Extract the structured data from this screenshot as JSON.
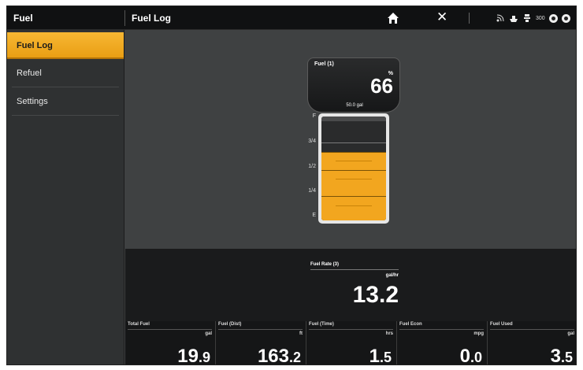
{
  "app": {
    "title": "Fuel"
  },
  "header": {
    "title": "Fuel Log"
  },
  "sidebar": {
    "items": [
      {
        "label": "Fuel Log"
      },
      {
        "label": "Refuel"
      },
      {
        "label": "Settings"
      }
    ]
  },
  "status": {
    "badge_text": "300"
  },
  "gauge": {
    "name": "Fuel (1)",
    "unit": "%",
    "value": "66",
    "capacity": "50.0 gal",
    "level_fraction": 0.66,
    "marks": [
      "F",
      "3/4",
      "1/2",
      "1/4",
      "E"
    ],
    "fill_color": "#f2a61f"
  },
  "fuel_rate": {
    "name": "Fuel Rate (3)",
    "unit": "gal/hr",
    "value": "13.2"
  },
  "cells": [
    {
      "name": "Total Fuel",
      "unit": "gal",
      "value_main": "19",
      "value_dec": ".9"
    },
    {
      "name": "Fuel (Dist)",
      "unit": "ft",
      "value_main": "163",
      "value_dec": ".2"
    },
    {
      "name": "Fuel (Time)",
      "unit": "hrs",
      "value_main": "1",
      "value_dec": ".5"
    },
    {
      "name": "Fuel Econ",
      "unit": "mpg",
      "value_main": "0",
      "value_dec": ".0"
    },
    {
      "name": "Fuel Used",
      "unit": "gal",
      "value_main": "3",
      "value_dec": ".5"
    }
  ],
  "colors": {
    "accent": "#f2a61f",
    "background": "#3f4142",
    "bar": "#101112"
  },
  "icons": [
    "home-icon",
    "close-icon",
    "gps-icon",
    "boat-icon",
    "sonar-icon",
    "network-icon",
    "alarm-icon"
  ]
}
